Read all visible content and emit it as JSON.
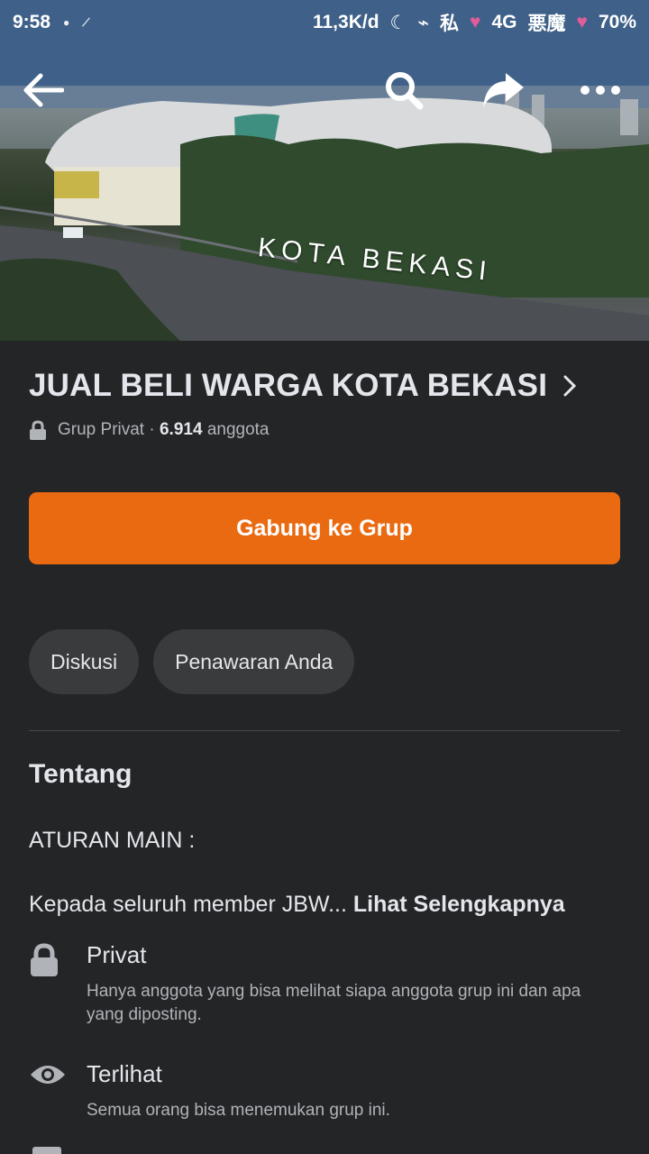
{
  "status_bar": {
    "time": "9:58",
    "speed": "11,3K/d",
    "network": "4G",
    "carrier_left": "私",
    "carrier_right": "悪魔",
    "battery": "70%"
  },
  "cover": {
    "sign_text": "KOTA BEKASI"
  },
  "group": {
    "title": "JUAL BELI WARGA KOTA BEKASI",
    "privacy_label": "Grup Privat ·",
    "member_count": "6.914",
    "member_label": "anggota"
  },
  "join_button": "Gabung ke Grup",
  "tabs": [
    {
      "label": "Diskusi"
    },
    {
      "label": "Penawaran Anda"
    }
  ],
  "about": {
    "title": "Tentang",
    "rules_heading": "ATURAN MAIN :",
    "description_preview": "Kepada seluruh member JBW... ",
    "see_more": "Lihat Selengkapnya",
    "privacy": {
      "title": "Privat",
      "description": "Hanya anggota yang bisa melihat siapa anggota grup ini dan apa yang diposting."
    },
    "visibility": {
      "title": "Terlihat",
      "description": "Semua orang bisa menemukan grup ini."
    }
  },
  "colors": {
    "background": "#242527",
    "accent": "#ea6a12",
    "chip": "#3a3b3c",
    "text_primary": "#e4e6eb",
    "text_secondary": "#b0b3b8"
  },
  "icons": [
    "back-arrow-icon",
    "search-icon",
    "share-icon",
    "more-icon",
    "chevron-right-icon",
    "lock-icon",
    "eye-icon"
  ]
}
